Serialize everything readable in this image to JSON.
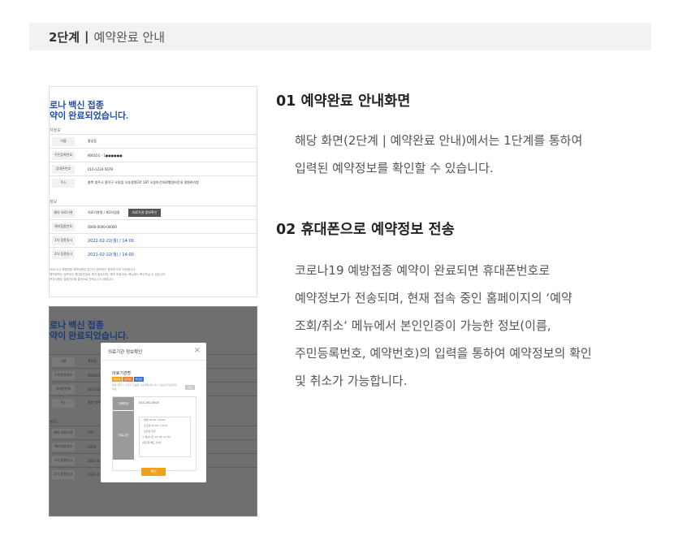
{
  "step": {
    "strong": "2단계",
    "separator": "|",
    "label": "예약완료 안내"
  },
  "sections": [
    {
      "heading": "01 예약완료 안내화면",
      "lines": [
        "해당 화면(2단계 | 예약완료 안내)에서는 1단계를 통하여",
        "입력된 예약정보를 확인할 수 있습니다."
      ]
    },
    {
      "heading": "02 휴대폰으로 예약정보 전송",
      "lines": [
        "코로나19 예방접종 예약이 완료되면 휴대폰번호로",
        "예약정보가 전송되며, 현재 접속 중인 홈페이지의 ‘예약",
        "조회/취소‘ 메뉴에서 본인인증이 가능한 정보(이름,",
        "주민등록번호, 예약번호)의 입력을 통하여 예약정보의 확인",
        "및 취소가 가능합니다."
      ]
    }
  ],
  "screenshot1": {
    "title_line1": "로나 백신 접종",
    "title_line2": "약이 완료되었습니다.",
    "section_a": "자정보",
    "rows_a": [
      {
        "k": "이름",
        "v": "홍길동"
      },
      {
        "k": "주민등록번호",
        "v": "900101 - 1●●●●●●"
      },
      {
        "k": "휴대폰번호",
        "v": "010-1234-5678"
      },
      {
        "k": "주소",
        "v": "충북 청주시 흥덕구 오송읍 오송생명2로 187 오송보건의료행정타운내 질병관리청"
      }
    ],
    "section_b": "정보",
    "rows_b": [
      {
        "k": "예약 의료기관",
        "v": "의료기관명 / 제1차접종",
        "btn": "의료기관 정보확인"
      },
      {
        "k": "예약접종번호",
        "v": "0000-0000-00000"
      },
      {
        "k": "1차 접종일시",
        "v": "2021-02-22(월) / 14:00"
      },
      {
        "k": "2차 접종일시",
        "v": "2021-02-22(월) / 14:00"
      }
    ],
    "notes": [
      "코로나19 예방접종 예약내용은 본인이 입력하신 정보에 따라 처리됩니다.",
      "예약정보는 입력하신 휴대폰번호로 문자 발송되며, 예약 조회/취소 메뉴에서 확인하실 수 있습니다.",
      "문의사항은 질병관리청 콜센터로 연락주시기 바랍니다."
    ]
  },
  "screenshot2": {
    "title_line1": "로나 백신 접종",
    "title_line2": "약이 완료되었습니다.",
    "rows": [
      {
        "k": "이름",
        "v": "홍길동"
      },
      {
        "k": "주민등록번호",
        "v": "900101"
      },
      {
        "k": "휴대폰번호",
        "v": "010-1234"
      },
      {
        "k": "주소",
        "v": "충북 청주"
      }
    ],
    "section_b": "정보",
    "rows_b": [
      {
        "k": "예약 의료기관",
        "v": "의료"
      },
      {
        "k": "예약접종번호",
        "v": "0000"
      },
      {
        "k": "1차 접종일시",
        "v": "2021-0"
      },
      {
        "k": "2차 접종일시",
        "v": "2021-0"
      }
    ],
    "modal": {
      "title": "의료기관 정보확인",
      "close": "×",
      "name": "의료기관명",
      "badges": [
        "화이자",
        "모더나",
        "백신명"
      ],
      "address": "충북 청주시 흥덕구 오송읍 오송생명2로 187 오송보건의료행정타운",
      "mini_btn": "지도",
      "phone_label": "전화번호",
      "phone_value": "043-200-0000",
      "hours_label": "진료시간",
      "hours": [
        "- 평일 09:00~18:00",
        "- 토요일 09:00~13:00",
        "- 일요일 휴무",
        "※ 점심시간 12:30~13:30",
        "(휴진일 별도 안내)"
      ],
      "ok": "확인"
    }
  },
  "colors": {
    "accent_blue": "#1f4fa8",
    "modal_button": "#f0a11c",
    "step_bg": "#f2f2f2"
  }
}
